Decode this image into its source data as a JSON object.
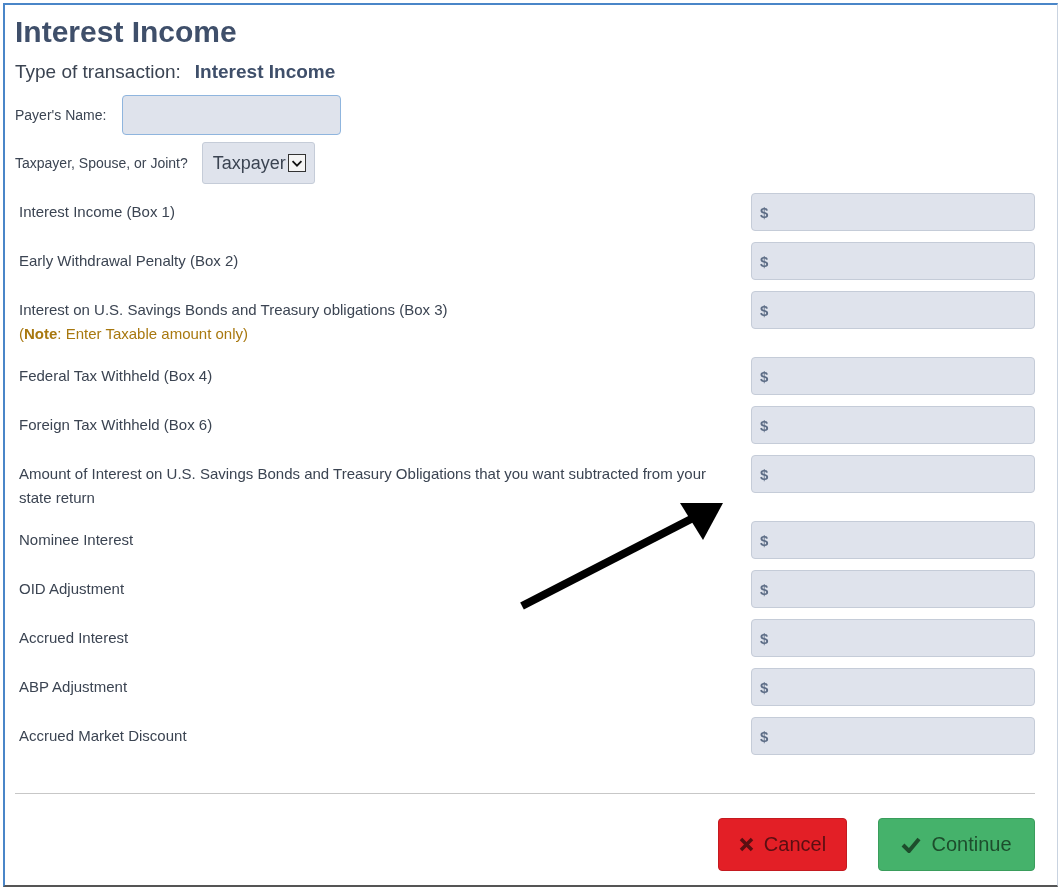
{
  "title": "Interest Income",
  "transaction": {
    "label": "Type of transaction:",
    "value": "Interest Income"
  },
  "payer_name": {
    "label": "Payer's Name:"
  },
  "owner": {
    "label": "Taxpayer, Spouse, or Joint?",
    "value": "Taxpayer"
  },
  "amounts": [
    {
      "label": "Interest Income (Box 1)",
      "prefix": "$"
    },
    {
      "label": "Early Withdrawal Penalty (Box 2)",
      "prefix": "$"
    },
    {
      "label": "Interest on U.S. Savings Bonds and Treasury obligations (Box 3)",
      "note": "(**Note**: Enter Taxable amount only)",
      "prefix": "$"
    },
    {
      "label": "Federal Tax Withheld (Box 4)",
      "prefix": "$"
    },
    {
      "label": "Foreign Tax Withheld (Box 6)",
      "prefix": "$"
    },
    {
      "label": "Amount of Interest on U.S. Savings Bonds and Treasury Obligations that you want subtracted from your state return",
      "prefix": "$"
    },
    {
      "label": "Nominee Interest",
      "prefix": "$"
    },
    {
      "label": "OID Adjustment",
      "prefix": "$"
    },
    {
      "label": "Accrued Interest",
      "prefix": "$"
    },
    {
      "label": "ABP Adjustment",
      "prefix": "$"
    },
    {
      "label": "Accrued Market Discount",
      "prefix": "$"
    }
  ],
  "buttons": [
    {
      "kind": "cancel",
      "label": "Cancel"
    },
    {
      "kind": "continue",
      "label": "Continue"
    }
  ]
}
